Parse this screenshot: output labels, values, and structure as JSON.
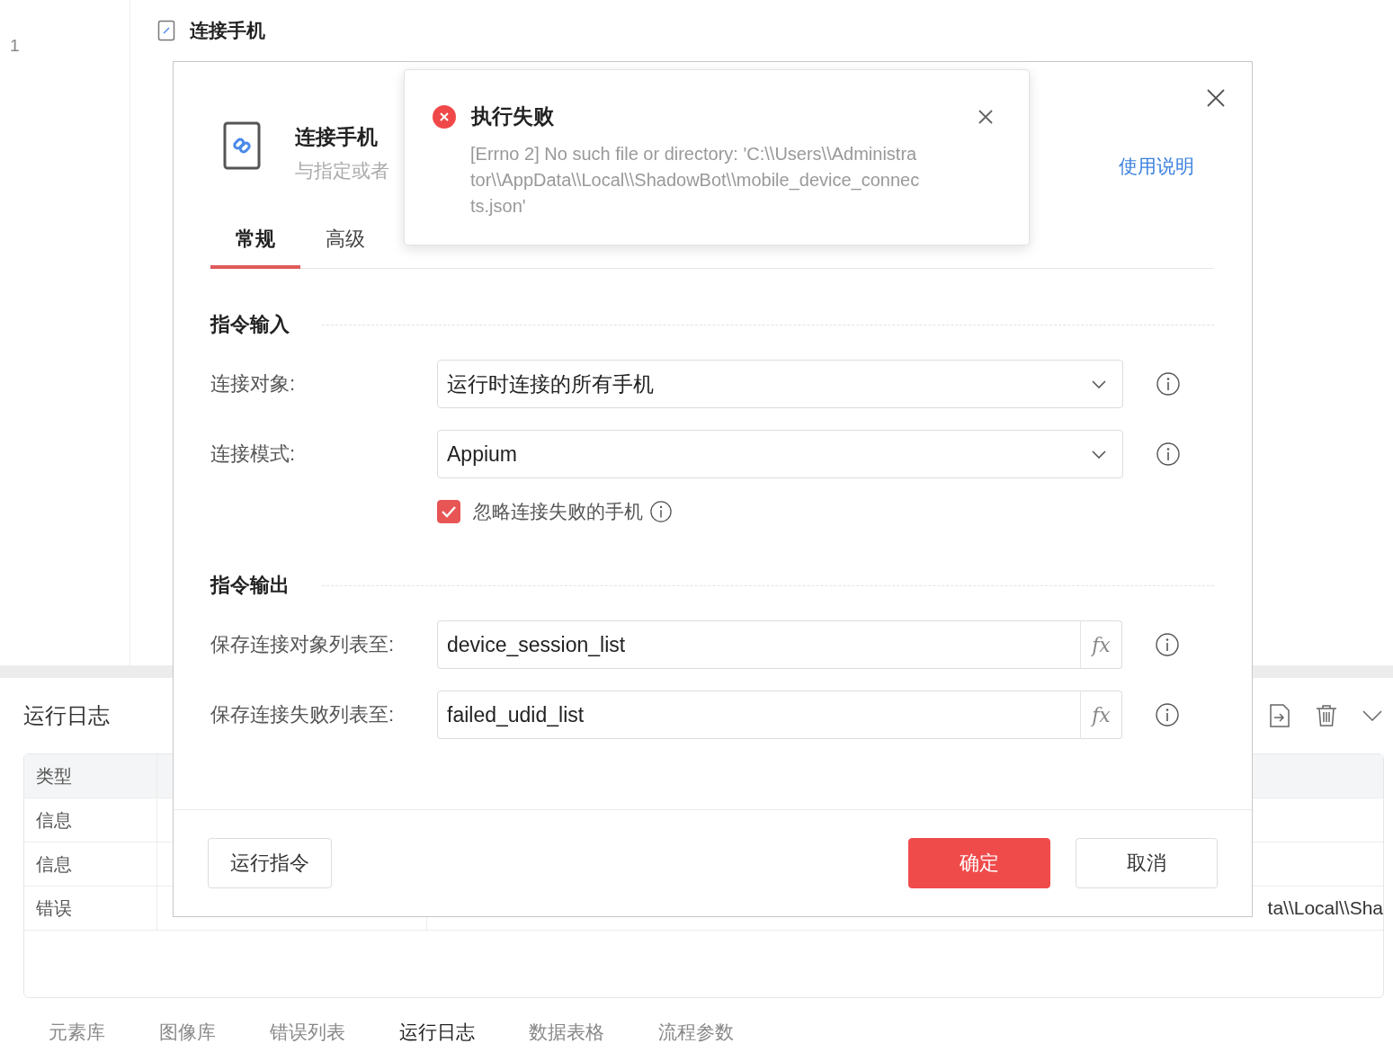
{
  "editor": {
    "line_number": "1",
    "step": {
      "title": "连接手机"
    }
  },
  "log_panel": {
    "title": "运行日志",
    "table": {
      "columns": [
        "类型"
      ],
      "rows": [
        {
          "type": "信息"
        },
        {
          "type": "信息"
        },
        {
          "type": "错误",
          "message": "ta\\\\Local\\\\Sha"
        }
      ]
    }
  },
  "bottom_tabs": [
    {
      "label": "元素库",
      "selected": false
    },
    {
      "label": "图像库",
      "selected": false
    },
    {
      "label": "错误列表",
      "selected": false
    },
    {
      "label": "运行日志",
      "selected": true
    },
    {
      "label": "数据表格",
      "selected": false
    },
    {
      "label": "流程参数",
      "selected": false
    }
  ],
  "dialog": {
    "title": "连接手机",
    "subtitle": "与指定或者",
    "help_link": "使用说明",
    "tabs": [
      {
        "label": "常规",
        "selected": true
      },
      {
        "label": "高级",
        "selected": false
      }
    ],
    "sections": [
      {
        "title": "指令输入",
        "fields": [
          {
            "kind": "select",
            "label": "连接对象:",
            "value": "运行时连接的所有手机"
          },
          {
            "kind": "select",
            "label": "连接模式:",
            "value": "Appium"
          },
          {
            "kind": "checkbox",
            "label": "忽略连接失败的手机",
            "checked": true
          }
        ]
      },
      {
        "title": "指令输出",
        "fields": [
          {
            "kind": "variable",
            "label": "保存连接对象列表至:",
            "value": "device_session_list",
            "button": "fx"
          },
          {
            "kind": "variable",
            "label": "保存连接失败列表至:",
            "value": "failed_udid_list",
            "button": "fx"
          }
        ]
      }
    ],
    "footer": {
      "left": [
        {
          "kind": "default",
          "label": "运行指令"
        }
      ],
      "right": [
        {
          "kind": "primary",
          "label": "确定"
        },
        {
          "kind": "default",
          "label": "取消"
        }
      ]
    }
  },
  "toast": {
    "kind": "error",
    "title": "执行失败",
    "message": "[Errno 2] No such file or directory: 'C:\\\\Users\\\\Administrator\\\\AppData\\\\Local\\\\ShadowBot\\\\mobile_device_connects.json'"
  }
}
